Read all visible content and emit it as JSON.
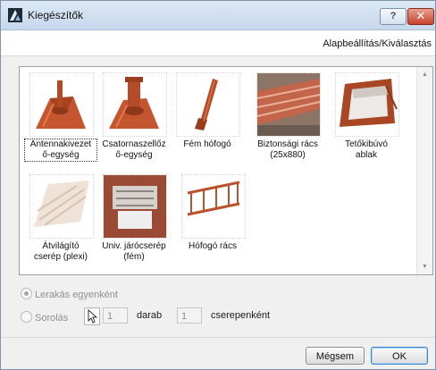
{
  "window": {
    "title": "Kiegészítők",
    "help_label": "?",
    "close_label": "✕"
  },
  "header": {
    "defaults_label": "Alapbeállítás/Kiválasztás"
  },
  "items": [
    {
      "label": "Antennakivezet\nő-egység",
      "icon": "antenna-tile-icon",
      "selected": true
    },
    {
      "label": "Csatornaszellőz\nő-egység",
      "icon": "vent-pipe-tile-icon",
      "selected": false
    },
    {
      "label": "Fém hófogó",
      "icon": "snow-hook-icon",
      "selected": false
    },
    {
      "label": "Biztonsági rács\n(25x880)",
      "icon": "safety-grate-icon",
      "selected": false
    },
    {
      "label": "Tetőkibúvó\nablak",
      "icon": "roof-hatch-icon",
      "selected": false
    },
    {
      "label": "Átvilágító\ncserép (plexi)",
      "icon": "clear-tile-icon",
      "selected": false
    },
    {
      "label": "Univ. járócserép\n(fém)",
      "icon": "walkway-tile-icon",
      "selected": false
    },
    {
      "label": "Hófogó rács",
      "icon": "snow-guard-grid-icon",
      "selected": false
    }
  ],
  "placement": {
    "single_label": "Lerakás egyenként",
    "row_label": "Sorolás",
    "count_value": "1",
    "count_unit_label": "darab",
    "every_value": "1",
    "every_unit_label": "cserepenként"
  },
  "buttons": {
    "cancel_label": "Mégsem",
    "ok_label": "OK"
  },
  "colors": {
    "accent": "#3b83c7",
    "terracotta": "#c4552f",
    "close_red": "#c7432c"
  }
}
